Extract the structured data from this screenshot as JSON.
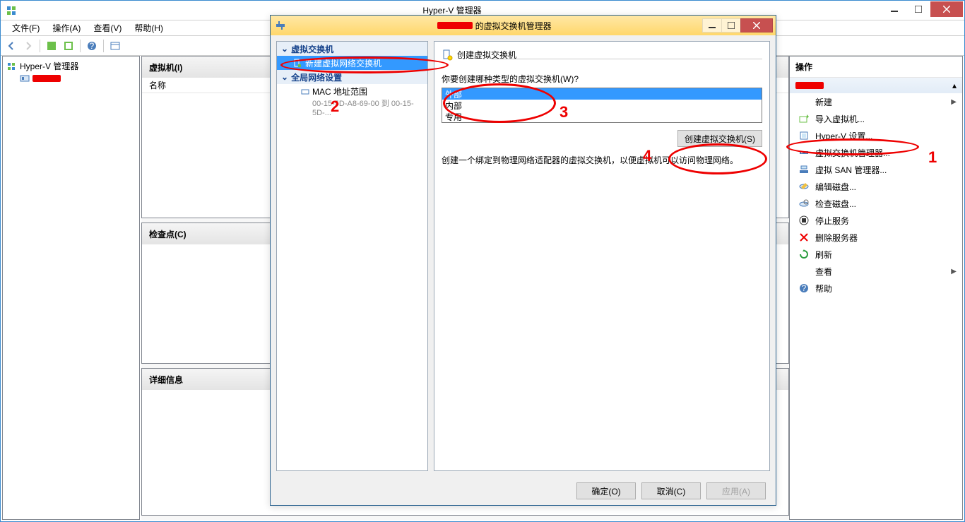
{
  "main": {
    "title": "Hyper-V 管理器",
    "menu": [
      "文件(F)",
      "操作(A)",
      "查看(V)",
      "帮助(H)"
    ]
  },
  "tree": {
    "root": "Hyper-V 管理器"
  },
  "center": {
    "vm_title": "虚拟机(I)",
    "vm_col": "名称",
    "cp_title": "检查点(C)",
    "detail_title": "详细信息"
  },
  "actions": {
    "title": "操作",
    "items": [
      "新建",
      "导入虚拟机...",
      "Hyper-V 设置...",
      "虚拟交换机管理器...",
      "虚拟 SAN 管理器...",
      "编辑磁盘...",
      "检查磁盘...",
      "停止服务",
      "删除服务器",
      "刷新",
      "查看",
      "帮助"
    ]
  },
  "dialog": {
    "title_suffix": "的虚拟交换机管理器",
    "left": {
      "sec1": "虚拟交换机",
      "new_switch": "新建虚拟网络交换机",
      "sec2": "全局网络设置",
      "mac_label": "MAC 地址范围",
      "mac_value": "00-15-5D-A8-69-00 到 00-15-5D-..."
    },
    "right": {
      "heading": "创建虚拟交换机",
      "q": "你要创建哪种类型的虚拟交换机(W)?",
      "opts": [
        "外部",
        "内部",
        "专用"
      ],
      "create_btn": "创建虚拟交换机(S)",
      "desc": "创建一个绑定到物理网络适配器的虚拟交换机，以便虚拟机可以访问物理网络。"
    },
    "footer": {
      "ok": "确定(O)",
      "cancel": "取消(C)",
      "apply": "应用(A)"
    }
  },
  "anno": {
    "n1": "1",
    "n2": "2",
    "n3": "3",
    "n4": "4"
  }
}
